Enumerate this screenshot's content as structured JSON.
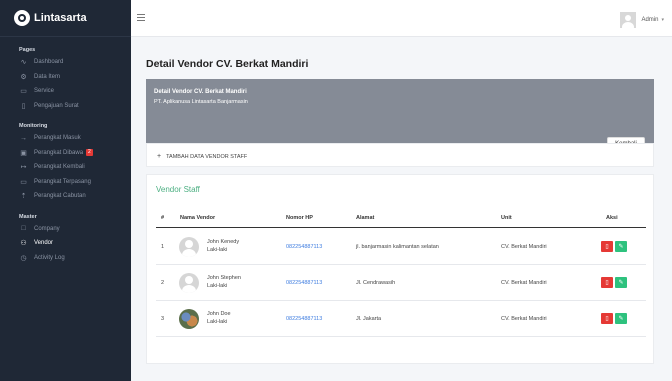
{
  "brand": {
    "name": "Lintasarta"
  },
  "sidebar": {
    "sections": [
      {
        "title": "Pages",
        "items": [
          {
            "label": "Dashboard",
            "icon": "pulse-icon"
          },
          {
            "label": "Data Item",
            "icon": "gear-icon"
          },
          {
            "label": "Service",
            "icon": "inbox-icon"
          },
          {
            "label": "Pengajuan Surat",
            "icon": "document-icon"
          }
        ]
      },
      {
        "title": "Monitoring",
        "items": [
          {
            "label": "Perangkat Masuk",
            "icon": "login-arrow-icon"
          },
          {
            "label": "Perangkat Dibawa",
            "icon": "gift-icon",
            "badge": "2"
          },
          {
            "label": "Perangkat Kembali",
            "icon": "return-arrow-icon"
          },
          {
            "label": "Perangkat Terpasang",
            "icon": "monitor-icon"
          },
          {
            "label": "Perangkat Cabutan",
            "icon": "upload-icon"
          }
        ]
      },
      {
        "title": "Master",
        "items": [
          {
            "label": "Company",
            "icon": "square-icon"
          },
          {
            "label": "Vendor",
            "icon": "users-icon",
            "active": true
          },
          {
            "label": "Activity Log",
            "icon": "clock-icon"
          }
        ]
      }
    ]
  },
  "topbar": {
    "user": "Admin",
    "caret": "▾"
  },
  "page": {
    "title": "Detail Vendor CV. Berkat Mandiri",
    "banner_title": "Detail Vendor CV. Berkat Mandiri",
    "banner_sub": "PT. Aplikanusa Lintasarta Banjarmasin",
    "back_button": "Kembali",
    "add_button": "TAMBAH DATA VENDOR STAFF",
    "add_icon": "+"
  },
  "table": {
    "title": "Vendor Staff",
    "headers": [
      "#",
      "Nama Vendor",
      "Nomor HP",
      "Alamat",
      "Unit",
      "Aksi"
    ],
    "rows": [
      {
        "no": "1",
        "name": "John Kenedy",
        "gender": "Laki-laki",
        "phone": "082254887113",
        "address": "jl. banjarmasin kalimantan selatan",
        "unit": "CV. Berkat Mandiri",
        "photo": false
      },
      {
        "no": "2",
        "name": "John Stephen",
        "gender": "Laki-laki",
        "phone": "082254887113",
        "address": "Jl. Cendrawasih",
        "unit": "CV. Berkat Mandiri",
        "photo": false
      },
      {
        "no": "3",
        "name": "John Doe",
        "gender": "Laki-laki",
        "phone": "082254887113",
        "address": "Jl. Jakarta",
        "unit": "CV. Berkat Mandiri",
        "photo": true
      }
    ]
  },
  "colors": {
    "sidebar": "#1f2836",
    "accent_green": "#4caf82",
    "delete": "#e53935",
    "edit": "#2ec27e",
    "link": "#3f7de0"
  }
}
